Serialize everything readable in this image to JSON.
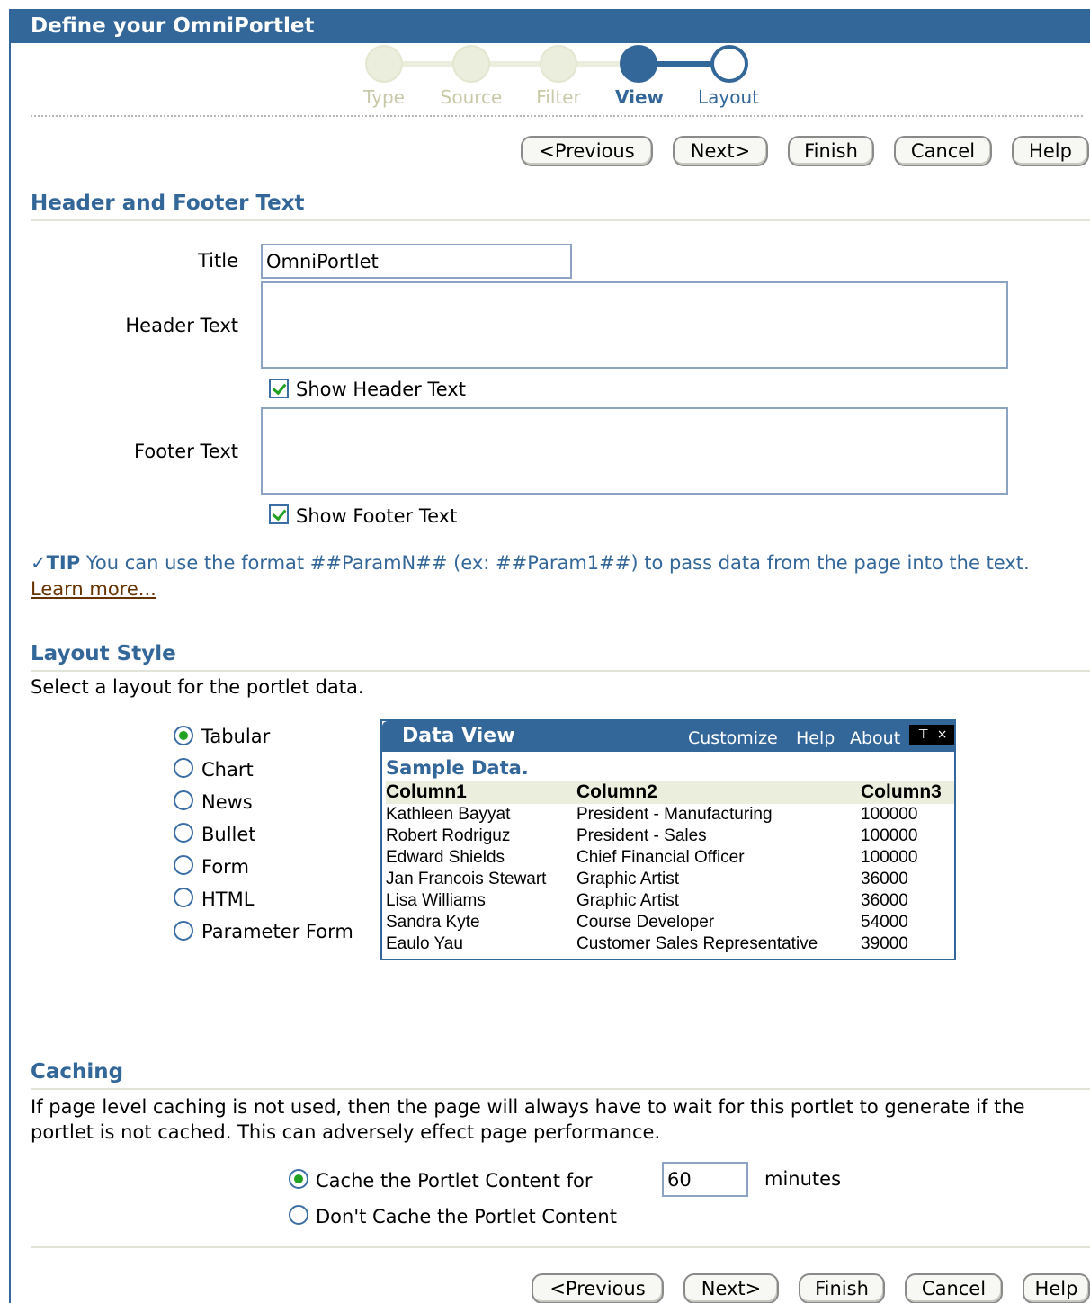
{
  "page": {
    "title": "Define your OmniPortlet"
  },
  "train": {
    "steps": [
      {
        "label": "Type",
        "state": "done"
      },
      {
        "label": "Source",
        "state": "done"
      },
      {
        "label": "Filter",
        "state": "done"
      },
      {
        "label": "View",
        "state": "current"
      },
      {
        "label": "Layout",
        "state": "next"
      }
    ]
  },
  "nav_buttons": {
    "previous": "<Previous",
    "next": "Next>",
    "finish": "Finish",
    "cancel": "Cancel",
    "help": "Help"
  },
  "header_footer": {
    "heading": "Header and Footer Text",
    "title_label": "Title",
    "title_value": "OmniPortlet",
    "header_label": "Header Text",
    "header_value": "",
    "show_header_label": "Show Header Text",
    "show_header_checked": true,
    "footer_label": "Footer Text",
    "footer_value": "",
    "show_footer_label": "Show Footer Text",
    "show_footer_checked": true
  },
  "tip": {
    "label": "TIP",
    "text": " You can use the format ##ParamN## (ex: ##Param1##) to pass data from the page into the text. ",
    "link": "Learn more..."
  },
  "layout_style": {
    "heading": "Layout Style",
    "instruction": "Select a layout for the portlet data.",
    "options": [
      {
        "label": "Tabular",
        "selected": true
      },
      {
        "label": "Chart",
        "selected": false
      },
      {
        "label": "News",
        "selected": false
      },
      {
        "label": "Bullet",
        "selected": false
      },
      {
        "label": "Form",
        "selected": false
      },
      {
        "label": "HTML",
        "selected": false
      },
      {
        "label": "Parameter Form",
        "selected": false
      }
    ],
    "preview": {
      "title": "Data View",
      "links": [
        "Customize",
        "Help",
        "About"
      ],
      "subtitle": "Sample Data.",
      "columns": [
        "Column1",
        "Column2",
        "Column3"
      ],
      "rows": [
        [
          "Kathleen Bayyat",
          "President - Manufacturing",
          "100000"
        ],
        [
          "Robert Rodriguz",
          "President - Sales",
          "100000"
        ],
        [
          "Edward Shields",
          "Chief Financial Officer",
          "100000"
        ],
        [
          "Jan Francois Stewart",
          "Graphic Artist",
          "36000"
        ],
        [
          "Lisa Williams",
          "Graphic Artist",
          "36000"
        ],
        [
          "Sandra Kyte",
          "Course Developer",
          "54000"
        ],
        [
          "Eaulo Yau",
          "Customer Sales Representative",
          "39000"
        ]
      ]
    }
  },
  "caching": {
    "heading": "Caching",
    "description": "If page level caching is not used, then the page will always have to wait for this portlet to generate if the portlet is not cached. This can adversely effect page performance.",
    "option_cache": "Cache the Portlet Content for",
    "cache_selected": true,
    "minutes_value": "60",
    "minutes_unit": "minutes",
    "option_no_cache": "Don't Cache the Portlet Content"
  }
}
